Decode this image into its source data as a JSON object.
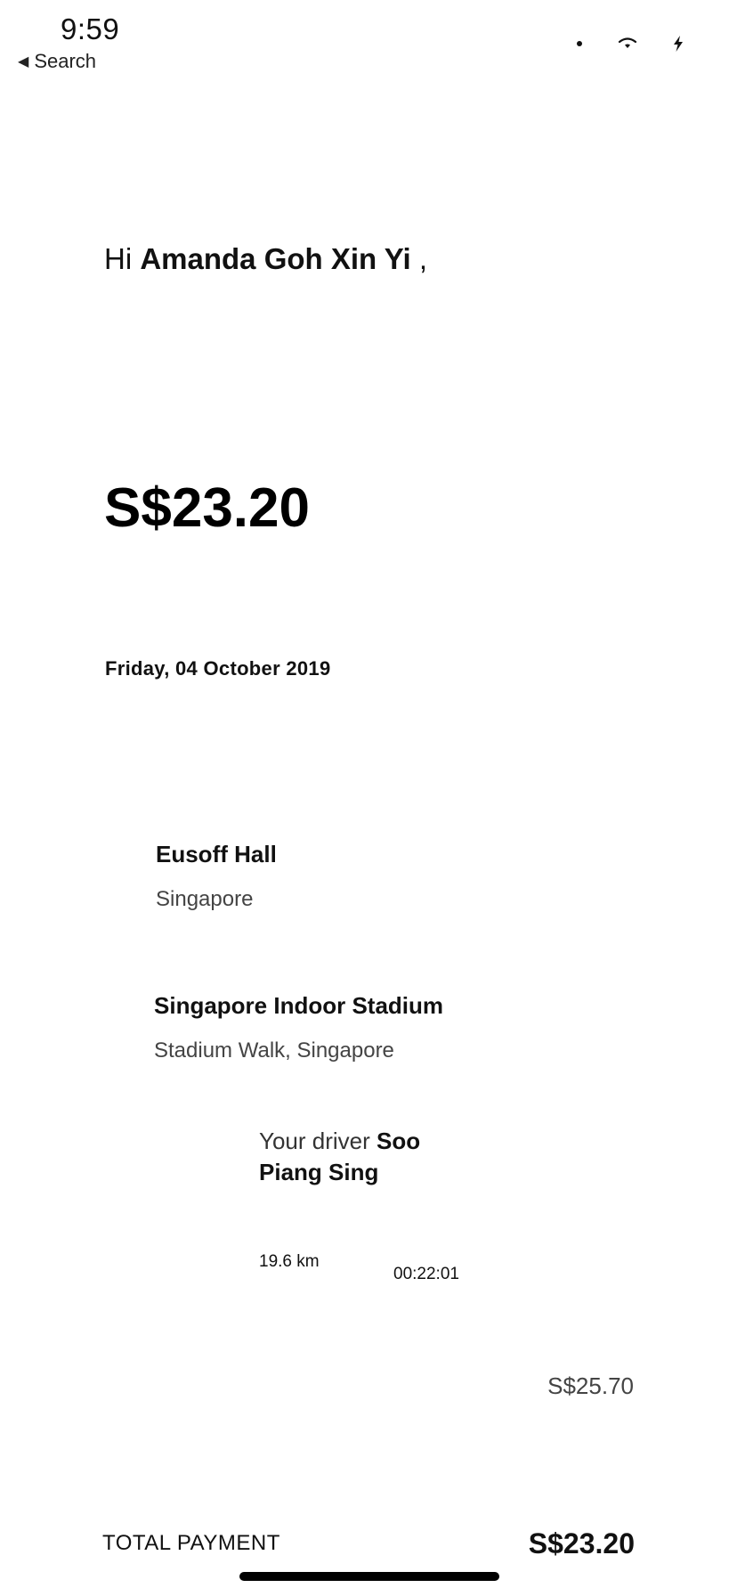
{
  "status_bar": {
    "time": "9:59",
    "back_label": "Search",
    "back_icon": "back-triangle-icon",
    "icons": [
      "signal-dot-icon",
      "wifi-icon",
      "charging-bolt-icon"
    ]
  },
  "receipt": {
    "greeting_prefix": "Hi",
    "customer_name": "Amanda Goh Xin Yi",
    "greeting_suffix": ",",
    "amount": "S$23.20",
    "date": "Friday, 04 October 2019",
    "pickup": {
      "title": "Eusoff Hall",
      "subtitle": "Singapore"
    },
    "dropoff": {
      "title": "Singapore Indoor Stadium",
      "subtitle": "Stadium Walk, Singapore"
    },
    "driver_prefix": "Your driver",
    "driver_name": "Soo Piang Sing",
    "distance": "19.6 km",
    "duration": "00:22:01",
    "fare": "S$25.70",
    "total_label": "TOTAL PAYMENT",
    "total_amount": "S$23.20"
  }
}
